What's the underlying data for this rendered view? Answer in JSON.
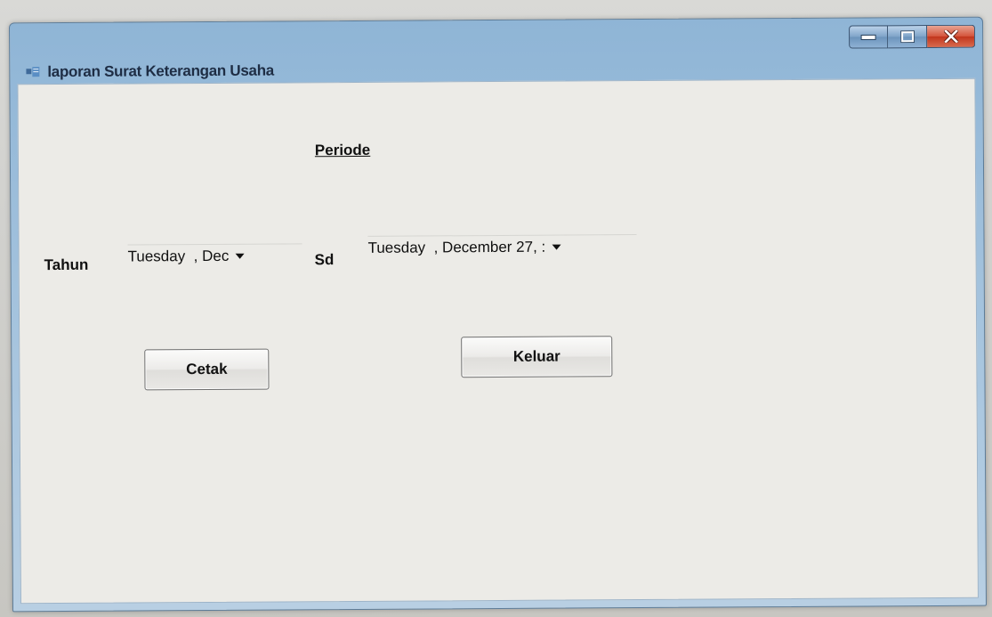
{
  "window": {
    "title": "laporan Surat Keterangan Usaha",
    "icon": "app-icon"
  },
  "caption_buttons": {
    "minimize_icon": "minimize-icon",
    "maximize_icon": "maximize-icon",
    "close_icon": "close-icon"
  },
  "form": {
    "periode_label": "Periode",
    "tahun_label": "Tahun",
    "sd_label": "Sd",
    "start_date_value": "Tuesday  , Dec",
    "end_date_value": "Tuesday  , December 27, :",
    "cetak_label": "Cetak",
    "keluar_label": "Keluar"
  },
  "colors": {
    "close_button": "#c1351c",
    "titlebar": "#8fb5d6",
    "client_area": "#ecebe7"
  }
}
